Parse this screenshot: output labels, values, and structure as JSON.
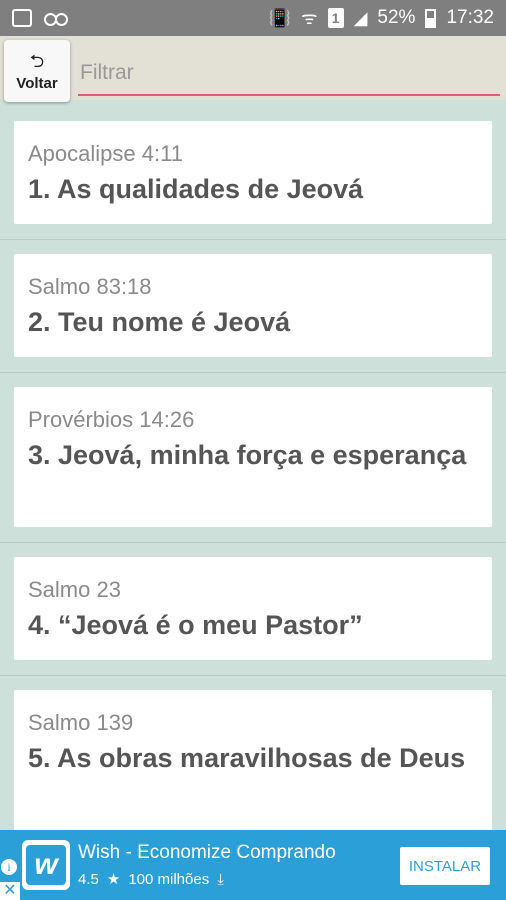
{
  "status_bar": {
    "left_icons": [
      "image-icon",
      "voicemail-icon"
    ],
    "right_icons": [
      "vibrate-icon",
      "wifi-icon",
      "sim-icon",
      "signal-icon"
    ],
    "sim_label": "1",
    "battery": "52%",
    "time": "17:32"
  },
  "toolbar": {
    "back_icon": "⮌",
    "back_label": "Voltar",
    "filter_placeholder": "Filtrar"
  },
  "items": [
    {
      "reference": "Apocalipse 4:11",
      "title": "1. As qualidades de Jeová"
    },
    {
      "reference": "Salmo 83:18",
      "title": "2. Teu nome é Jeová"
    },
    {
      "reference": "Provérbios 14:26",
      "title": "3. Jeová, minha força e esperança"
    },
    {
      "reference": "Salmo 23",
      "title": "4. “Jeová é o meu Pastor”"
    },
    {
      "reference": "Salmo 139",
      "title": "5. As obras maravilhosas de Deus"
    }
  ],
  "ad": {
    "app_name": "Wish - Economize Comprando",
    "rating": "4.5",
    "downloads": "100 milhões",
    "install_label": "INSTALAR",
    "info_symbol": "i",
    "close_symbol": "✕",
    "logo_letter": "w",
    "accent": "#2a9fd8"
  }
}
